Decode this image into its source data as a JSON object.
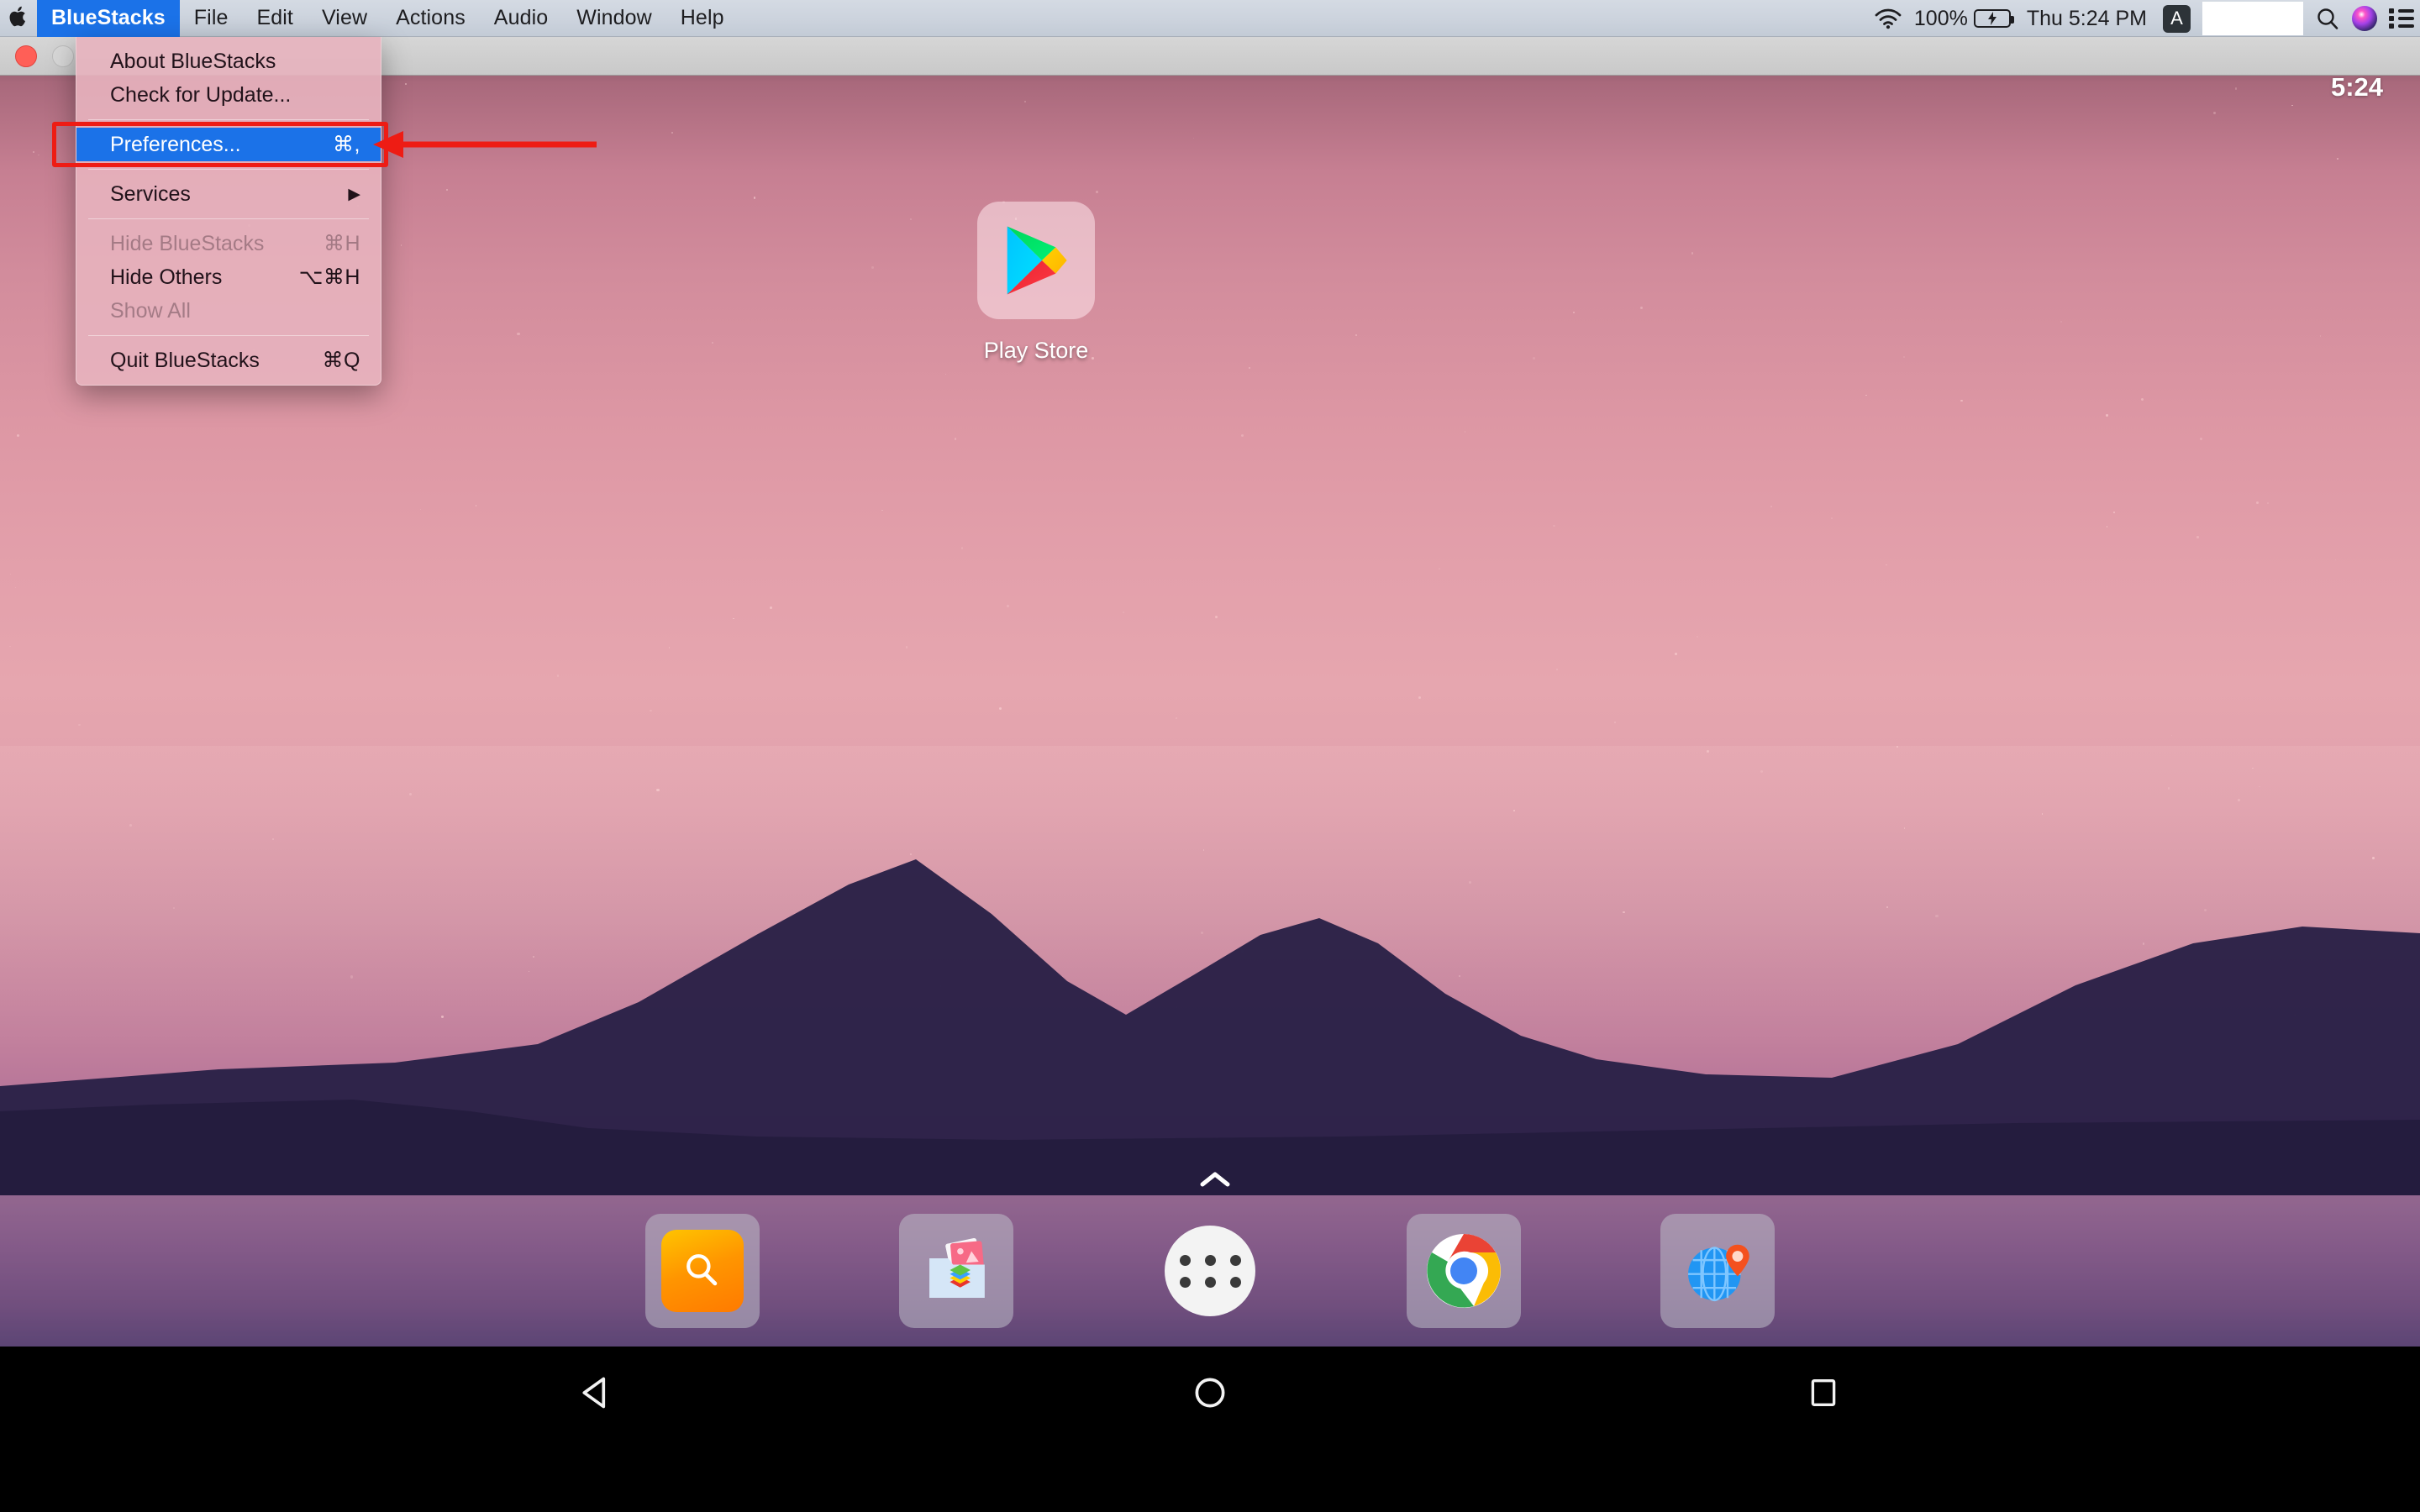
{
  "menubar": {
    "apple_icon": "apple-logo-icon",
    "items": [
      {
        "label": "BlueStacks",
        "active": true
      },
      {
        "label": "File",
        "active": false
      },
      {
        "label": "Edit",
        "active": false
      },
      {
        "label": "View",
        "active": false
      },
      {
        "label": "Actions",
        "active": false
      },
      {
        "label": "Audio",
        "active": false
      },
      {
        "label": "Window",
        "active": false
      },
      {
        "label": "Help",
        "active": false
      }
    ],
    "status": {
      "wifi_icon": "wifi-icon",
      "battery_percent": "100%",
      "battery_icon": "battery-charging-icon",
      "clock": "Thu 5:24 PM",
      "input_source": "A",
      "redacted_icon": "redacted-box",
      "search_icon": "search-icon",
      "siri_icon": "siri-icon",
      "control_center_icon": "control-center-icon"
    }
  },
  "window": {
    "close_button": "close-window-button",
    "minimize_button": "minimize-window-button"
  },
  "bluestacks_menu": {
    "items": [
      {
        "label": "About BlueStacks",
        "shortcut": "",
        "state": "enabled",
        "type": "item"
      },
      {
        "label": "Check for Update...",
        "shortcut": "",
        "state": "enabled",
        "type": "item"
      },
      {
        "type": "separator"
      },
      {
        "label": "Preferences...",
        "shortcut": "⌘,",
        "state": "highlighted",
        "type": "item"
      },
      {
        "type": "separator"
      },
      {
        "label": "Services",
        "shortcut": "",
        "state": "enabled",
        "type": "submenu"
      },
      {
        "type": "separator"
      },
      {
        "label": "Hide BlueStacks",
        "shortcut": "⌘H",
        "state": "disabled",
        "type": "item"
      },
      {
        "label": "Hide Others",
        "shortcut": "⌥⌘H",
        "state": "enabled",
        "type": "item"
      },
      {
        "label": "Show All",
        "shortcut": "",
        "state": "disabled",
        "type": "item"
      },
      {
        "type": "separator"
      },
      {
        "label": "Quit BlueStacks",
        "shortcut": "⌘Q",
        "state": "enabled",
        "type": "item"
      }
    ]
  },
  "annotation": {
    "color": "#ee1c14",
    "highlight_rect_target": "Preferences...",
    "arrow_direction": "left"
  },
  "android": {
    "clock": "5:24",
    "home_apps": [
      {
        "label": "Play Store",
        "icon": "play-store-icon"
      }
    ],
    "drawer_chevron_icon": "chevron-up-icon",
    "dock": [
      {
        "label": "Search",
        "icon": "search-app-icon"
      },
      {
        "label": "Media Manager",
        "icon": "media-manager-icon"
      },
      {
        "label": "All Apps",
        "icon": "app-drawer-icon"
      },
      {
        "label": "Chrome",
        "icon": "chrome-icon"
      },
      {
        "label": "Browser",
        "icon": "globe-pin-icon"
      }
    ],
    "navbar": [
      {
        "label": "Back",
        "icon": "back-triangle-icon"
      },
      {
        "label": "Home",
        "icon": "home-circle-icon"
      },
      {
        "label": "Recents",
        "icon": "recents-square-icon"
      }
    ]
  },
  "colors": {
    "accent_blue": "#1b72e8",
    "annotation_red": "#ee1c14",
    "menubar_bg": "#ccd3dd",
    "menu_bg": "#e7b2be"
  }
}
